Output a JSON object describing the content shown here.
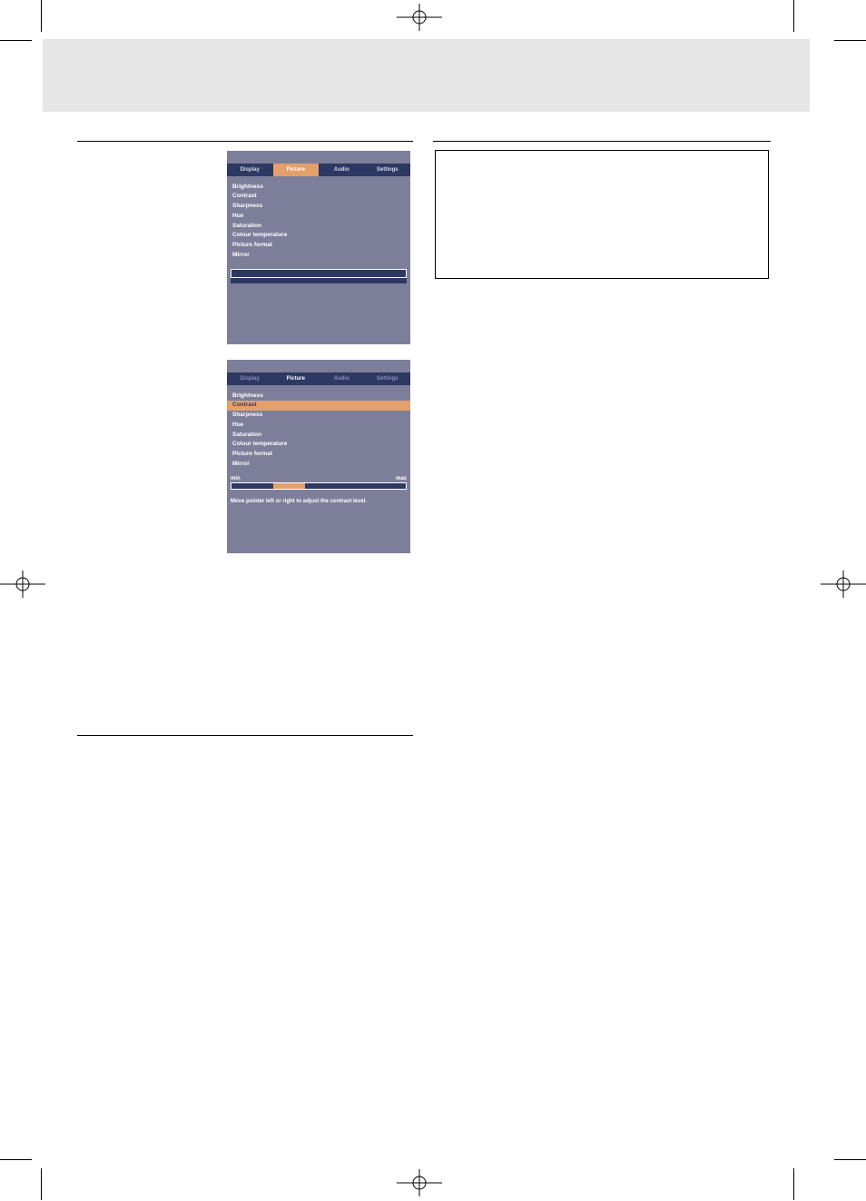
{
  "tabs": {
    "display": "Display",
    "picture": "Picture",
    "audio": "Audio",
    "settings": "Settings"
  },
  "menu_items": {
    "brightness": "Brightness",
    "contrast": "Contrast",
    "sharpness": "Sharpness",
    "hue": "Hue",
    "saturation": "Saturation",
    "colour_temperature": "Colour temperature",
    "picture_format": "Picture format",
    "mirror": "Mirror"
  },
  "slider": {
    "min_label": "min",
    "max_label": "max"
  },
  "hint": "Move pointer left or right to adjust the contrast level."
}
